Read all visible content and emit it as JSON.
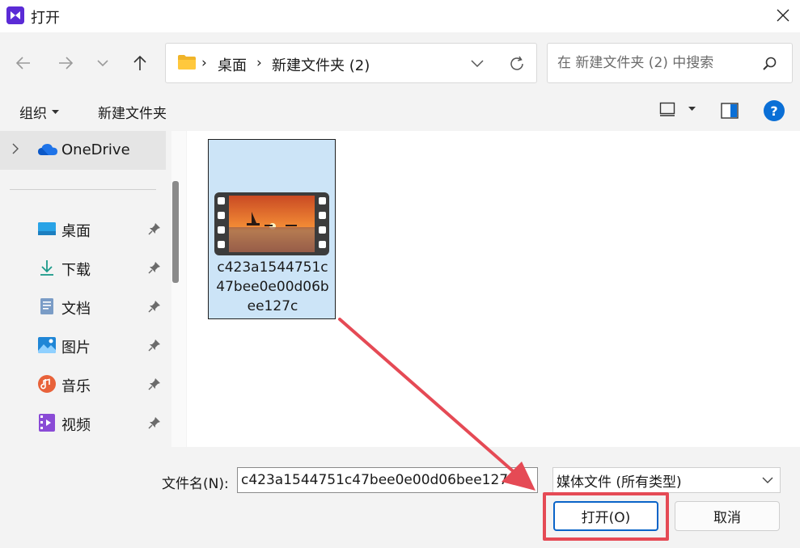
{
  "window": {
    "title": "打开",
    "accent": "#5b2bd6"
  },
  "nav": {
    "breadcrumb": [
      "桌面",
      "新建文件夹 (2)"
    ],
    "breadcrumb_sep": "›",
    "search_placeholder": "在 新建文件夹 (2) 中搜索"
  },
  "commands": {
    "organize": "组织",
    "new_folder": "新建文件夹",
    "help": "?"
  },
  "sidebar": {
    "onedrive": "OneDrive",
    "items": [
      {
        "label": "桌面",
        "icon": "desktop-icon"
      },
      {
        "label": "下载",
        "icon": "download-icon"
      },
      {
        "label": "文档",
        "icon": "document-icon"
      },
      {
        "label": "图片",
        "icon": "picture-icon"
      },
      {
        "label": "音乐",
        "icon": "music-icon"
      },
      {
        "label": "视频",
        "icon": "video-icon"
      }
    ]
  },
  "files": [
    {
      "name": "c423a1544751c47bee0e00d06bee127c",
      "icon": "video-file-thumbnail",
      "selected": true
    }
  ],
  "bottom": {
    "filename_label": "文件名(N):",
    "filename_value": "c423a1544751c47bee0e00d06bee127c",
    "filetype": "媒体文件 (所有类型)",
    "open": "打开(O)",
    "cancel": "取消"
  },
  "annotation": {
    "color": "#e54a55"
  }
}
